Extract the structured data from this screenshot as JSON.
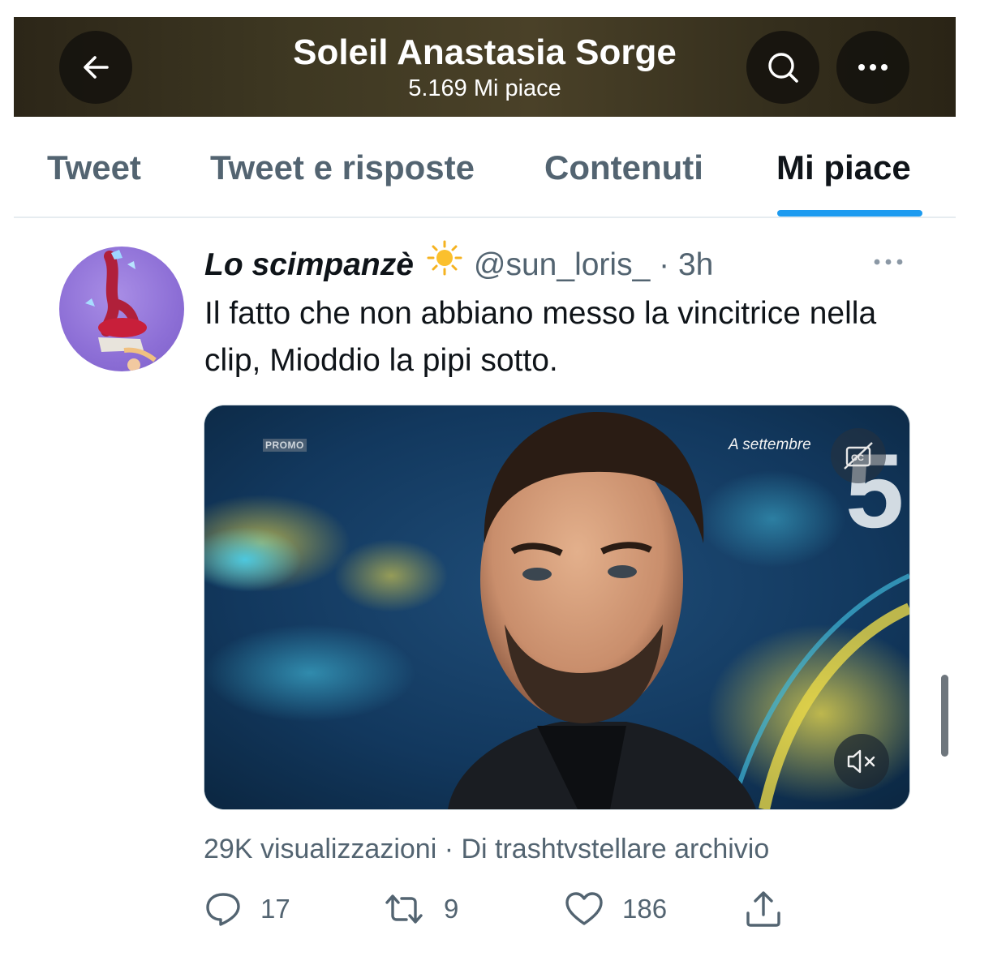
{
  "header": {
    "title": "Soleil Anastasia Sorge",
    "likes_count": "5.169 Mi piace"
  },
  "tabs": [
    {
      "label": "Tweet",
      "active": false
    },
    {
      "label": "Tweet e risposte",
      "active": false
    },
    {
      "label": "Contenuti",
      "active": false
    },
    {
      "label": "Mi piace",
      "active": true
    }
  ],
  "tweet": {
    "author_name": "Lo scimpanzè",
    "author_emoji": "sun-emoji",
    "handle": "@sun_loris_",
    "separator": "·",
    "time": "3h",
    "text": "Il fatto che non abbiano messo la vincitrice nella clip, Mioddio la pipi sotto.",
    "video": {
      "promo_label": "PROMO",
      "overlay_text": "A settembre",
      "channel_logo": "5"
    },
    "views_line": "29K visualizzazioni · Di trashtvstellare archivio",
    "actions": {
      "replies": "17",
      "retweets": "9",
      "likes": "186"
    }
  },
  "colors": {
    "accent": "#1d9bf0",
    "secondary_text": "#536471",
    "primary_text": "#0f1419"
  }
}
